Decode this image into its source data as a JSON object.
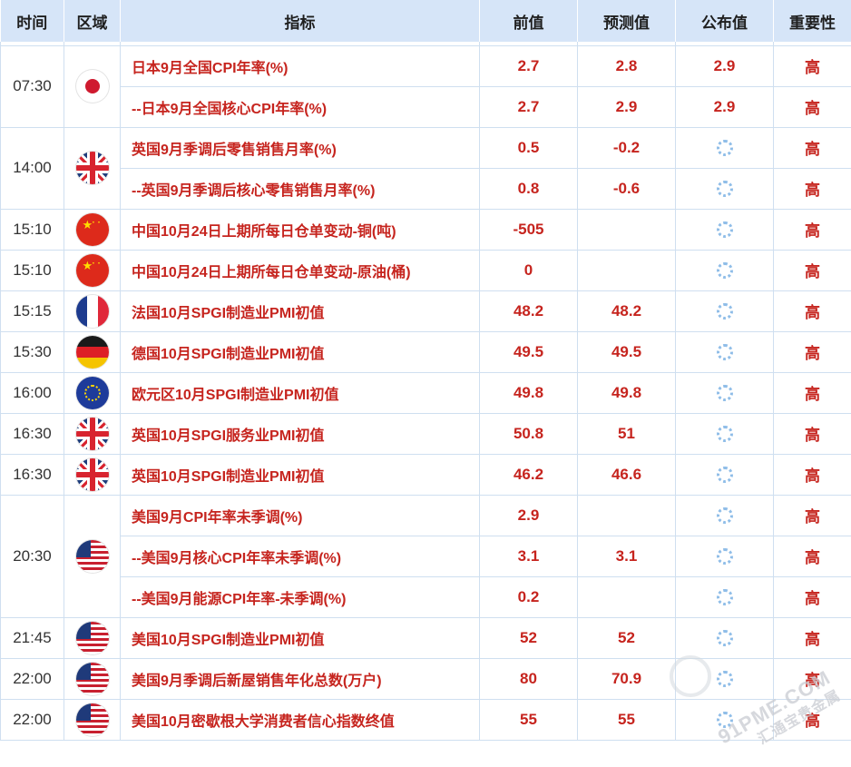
{
  "header": {
    "time": "时间",
    "region": "区域",
    "indicator": "指标",
    "previous": "前值",
    "forecast": "预测值",
    "actual": "公布值",
    "importance": "重要性"
  },
  "groups": [
    {
      "time": "07:30",
      "flag": "jp",
      "flag_icon": "japan-flag-icon",
      "rows": [
        {
          "indicator": "日本9月全国CPI年率(%)",
          "previous": "2.7",
          "forecast": "2.8",
          "actual": "2.9",
          "importance": "高"
        },
        {
          "indicator": "--日本9月全国核心CPI年率(%)",
          "previous": "2.7",
          "forecast": "2.9",
          "actual": "2.9",
          "importance": "高"
        }
      ]
    },
    {
      "time": "14:00",
      "flag": "gb",
      "flag_icon": "uk-flag-icon",
      "rows": [
        {
          "indicator": "英国9月季调后零售销售月率(%)",
          "previous": "0.5",
          "forecast": "-0.2",
          "actual": "",
          "importance": "高"
        },
        {
          "indicator": "--英国9月季调后核心零售销售月率(%)",
          "previous": "0.8",
          "forecast": "-0.6",
          "actual": "",
          "importance": "高"
        }
      ]
    },
    {
      "time": "15:10",
      "flag": "cn",
      "flag_icon": "china-flag-icon",
      "rows": [
        {
          "indicator": "中国10月24日上期所每日仓单变动-铜(吨)",
          "previous": "-505",
          "forecast": "",
          "actual": "",
          "importance": "高"
        }
      ]
    },
    {
      "time": "15:10",
      "flag": "cn",
      "flag_icon": "china-flag-icon",
      "rows": [
        {
          "indicator": "中国10月24日上期所每日仓单变动-原油(桶)",
          "previous": "0",
          "forecast": "",
          "actual": "",
          "importance": "高"
        }
      ]
    },
    {
      "time": "15:15",
      "flag": "fr",
      "flag_icon": "france-flag-icon",
      "rows": [
        {
          "indicator": "法国10月SPGI制造业PMI初值",
          "previous": "48.2",
          "forecast": "48.2",
          "actual": "",
          "importance": "高"
        }
      ]
    },
    {
      "time": "15:30",
      "flag": "de",
      "flag_icon": "germany-flag-icon",
      "rows": [
        {
          "indicator": "德国10月SPGI制造业PMI初值",
          "previous": "49.5",
          "forecast": "49.5",
          "actual": "",
          "importance": "高"
        }
      ]
    },
    {
      "time": "16:00",
      "flag": "eu",
      "flag_icon": "eu-flag-icon",
      "rows": [
        {
          "indicator": "欧元区10月SPGI制造业PMI初值",
          "previous": "49.8",
          "forecast": "49.8",
          "actual": "",
          "importance": "高"
        }
      ]
    },
    {
      "time": "16:30",
      "flag": "gb",
      "flag_icon": "uk-flag-icon",
      "rows": [
        {
          "indicator": "英国10月SPGI服务业PMI初值",
          "previous": "50.8",
          "forecast": "51",
          "actual": "",
          "importance": "高"
        }
      ]
    },
    {
      "time": "16:30",
      "flag": "gb",
      "flag_icon": "uk-flag-icon",
      "rows": [
        {
          "indicator": "英国10月SPGI制造业PMI初值",
          "previous": "46.2",
          "forecast": "46.6",
          "actual": "",
          "importance": "高"
        }
      ]
    },
    {
      "time": "20:30",
      "flag": "us",
      "flag_icon": "usa-flag-icon",
      "rows": [
        {
          "indicator": "美国9月CPI年率未季调(%)",
          "previous": "2.9",
          "forecast": "",
          "actual": "",
          "importance": "高"
        },
        {
          "indicator": "--美国9月核心CPI年率未季调(%)",
          "previous": "3.1",
          "forecast": "3.1",
          "actual": "",
          "importance": "高"
        },
        {
          "indicator": "--美国9月能源CPI年率-未季调(%)",
          "previous": "0.2",
          "forecast": "",
          "actual": "",
          "importance": "高"
        }
      ]
    },
    {
      "time": "21:45",
      "flag": "us",
      "flag_icon": "usa-flag-icon",
      "rows": [
        {
          "indicator": "美国10月SPGI制造业PMI初值",
          "previous": "52",
          "forecast": "52",
          "actual": "",
          "importance": "高"
        }
      ]
    },
    {
      "time": "22:00",
      "flag": "us",
      "flag_icon": "usa-flag-icon",
      "rows": [
        {
          "indicator": "美国9月季调后新屋销售年化总数(万户)",
          "previous": "80",
          "forecast": "70.9",
          "actual": "",
          "importance": "高"
        }
      ]
    },
    {
      "time": "22:00",
      "flag": "us",
      "flag_icon": "usa-flag-icon",
      "rows": [
        {
          "indicator": "美国10月密歇根大学消费者信心指数终值",
          "previous": "55",
          "forecast": "55",
          "actual": "",
          "importance": "高"
        }
      ]
    }
  ],
  "watermark": {
    "line1": "91PME.COM",
    "line2": "汇通宝贵金属"
  },
  "colors": {
    "header_bg": "#d6e5f8",
    "accent_red": "#c6241e",
    "grid": "#cfdff0",
    "spinner": "#8fbde8"
  }
}
